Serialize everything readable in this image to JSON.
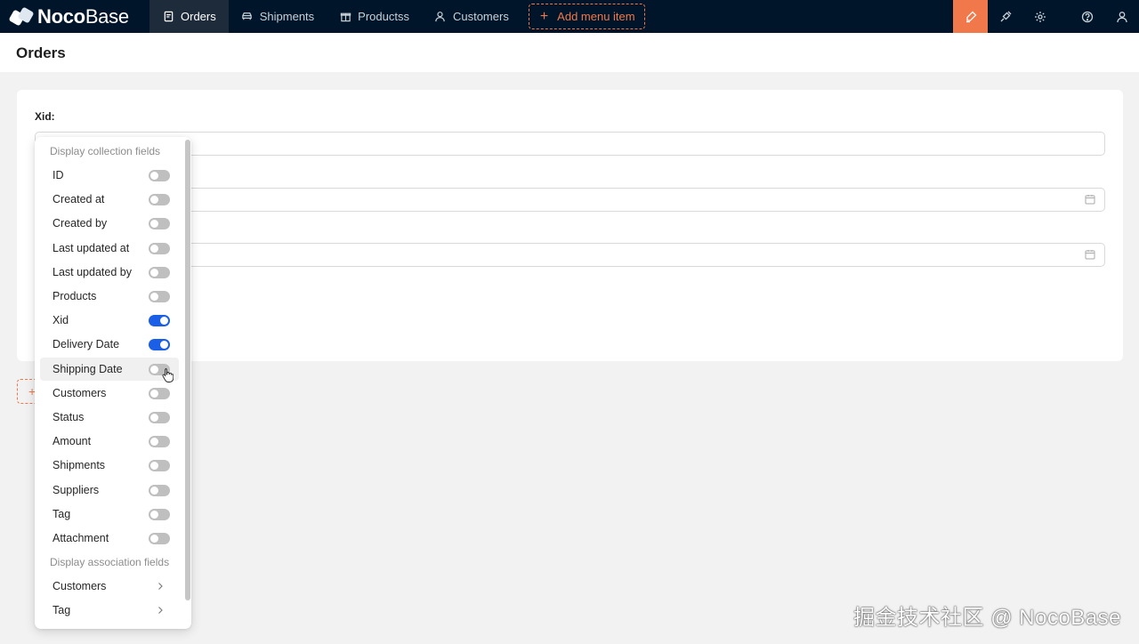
{
  "app": {
    "logo_bold": "Noco",
    "logo_light": "Base"
  },
  "nav": {
    "items": [
      {
        "label": "Orders",
        "icon": "document-icon",
        "active": true
      },
      {
        "label": "Shipments",
        "icon": "car-icon"
      },
      {
        "label": "Productss",
        "icon": "gift-icon"
      },
      {
        "label": "Customers",
        "icon": "user-icon"
      }
    ],
    "add_menu_label": "Add menu item",
    "right_icons": [
      "highlight-icon",
      "plugin-icon",
      "settings-icon",
      "help-icon",
      "user-icon"
    ]
  },
  "page": {
    "title": "Orders"
  },
  "form": {
    "xid_label": "Xid",
    "label_suffix": ":"
  },
  "dropdown": {
    "collection_title": "Display collection fields",
    "collection_fields": [
      {
        "label": "ID",
        "on": false
      },
      {
        "label": "Created at",
        "on": false
      },
      {
        "label": "Created by",
        "on": false
      },
      {
        "label": "Last updated at",
        "on": false
      },
      {
        "label": "Last updated by",
        "on": false
      },
      {
        "label": "Products",
        "on": false
      },
      {
        "label": "Xid",
        "on": true
      },
      {
        "label": "Delivery Date",
        "on": true
      },
      {
        "label": "Shipping Date",
        "on": false,
        "hovered": true
      },
      {
        "label": "Customers",
        "on": false
      },
      {
        "label": "Status",
        "on": false
      },
      {
        "label": "Amount",
        "on": false
      },
      {
        "label": "Shipments",
        "on": false
      },
      {
        "label": "Suppliers",
        "on": false
      },
      {
        "label": "Tag",
        "on": false
      },
      {
        "label": "Attachment",
        "on": false
      }
    ],
    "association_title": "Display association fields",
    "association_fields": [
      {
        "label": "Customers"
      },
      {
        "label": "Tag"
      }
    ]
  },
  "watermark": "掘金技术社区 @ NocoBase",
  "colors": {
    "accent": "#f0784a",
    "nav_bg": "#001529",
    "toggle_on": "#1a5fe6"
  }
}
